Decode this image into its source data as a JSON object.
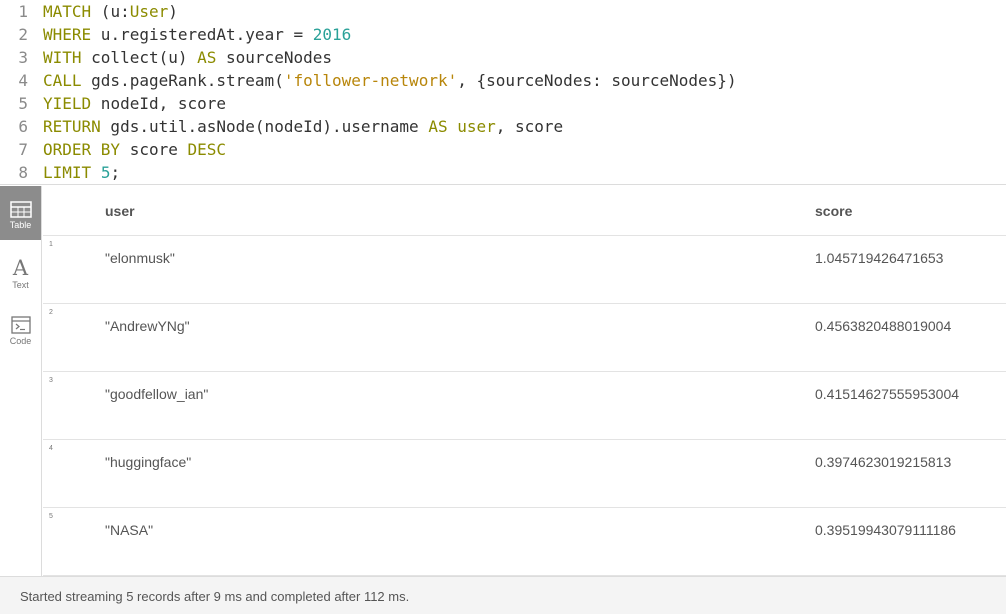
{
  "editor": {
    "lines": [
      {
        "num": "1",
        "tokens": [
          {
            "t": "MATCH",
            "c": "kw"
          },
          {
            "t": " (u:",
            "c": ""
          },
          {
            "t": "User",
            "c": "lbl"
          },
          {
            "t": ")",
            "c": ""
          }
        ]
      },
      {
        "num": "2",
        "tokens": [
          {
            "t": "WHERE",
            "c": "kw"
          },
          {
            "t": " u.registeredAt.year = ",
            "c": ""
          },
          {
            "t": "2016",
            "c": "num"
          }
        ]
      },
      {
        "num": "3",
        "tokens": [
          {
            "t": "WITH",
            "c": "kw"
          },
          {
            "t": " collect(u) ",
            "c": ""
          },
          {
            "t": "AS",
            "c": "kw"
          },
          {
            "t": " sourceNodes",
            "c": ""
          }
        ]
      },
      {
        "num": "4",
        "tokens": [
          {
            "t": "CALL",
            "c": "kw"
          },
          {
            "t": " gds.pageRank.stream(",
            "c": ""
          },
          {
            "t": "'follower-network'",
            "c": "str"
          },
          {
            "t": ", {sourceNodes: sourceNodes})",
            "c": ""
          }
        ]
      },
      {
        "num": "5",
        "tokens": [
          {
            "t": "YIELD",
            "c": "kw"
          },
          {
            "t": " nodeId, score",
            "c": ""
          }
        ]
      },
      {
        "num": "6",
        "tokens": [
          {
            "t": "RETURN",
            "c": "kw"
          },
          {
            "t": " gds.util.asNode(nodeId).username ",
            "c": ""
          },
          {
            "t": "AS",
            "c": "kw"
          },
          {
            "t": " ",
            "c": ""
          },
          {
            "t": "user",
            "c": "lbl"
          },
          {
            "t": ", score",
            "c": ""
          }
        ]
      },
      {
        "num": "7",
        "tokens": [
          {
            "t": "ORDER BY",
            "c": "kw"
          },
          {
            "t": " score ",
            "c": ""
          },
          {
            "t": "DESC",
            "c": "kw"
          }
        ]
      },
      {
        "num": "8",
        "tokens": [
          {
            "t": "LIMIT",
            "c": "kw"
          },
          {
            "t": " ",
            "c": ""
          },
          {
            "t": "5",
            "c": "num"
          },
          {
            "t": ";",
            "c": ""
          }
        ]
      }
    ]
  },
  "sidebar": {
    "table_label": "Table",
    "text_label": "Text",
    "text_glyph": "A",
    "code_label": "Code"
  },
  "table": {
    "columns": [
      "user",
      "score"
    ],
    "rows": [
      {
        "n": "1",
        "user": "\"elonmusk\"",
        "score": "1.045719426471653"
      },
      {
        "n": "2",
        "user": "\"AndrewYNg\"",
        "score": "0.4563820488019004"
      },
      {
        "n": "3",
        "user": "\"goodfellow_ian\"",
        "score": "0.41514627555953004"
      },
      {
        "n": "4",
        "user": "\"huggingface\"",
        "score": "0.3974623019215813"
      },
      {
        "n": "5",
        "user": "\"NASA\"",
        "score": "0.39519943079111186"
      }
    ]
  },
  "footer": {
    "status": "Started streaming 5 records after 9 ms and completed after 112 ms."
  },
  "colors": {
    "keyword": "#8b8b00",
    "number": "#2aa198",
    "string": "#b8860b",
    "active_tab": "#8c8c8c"
  }
}
